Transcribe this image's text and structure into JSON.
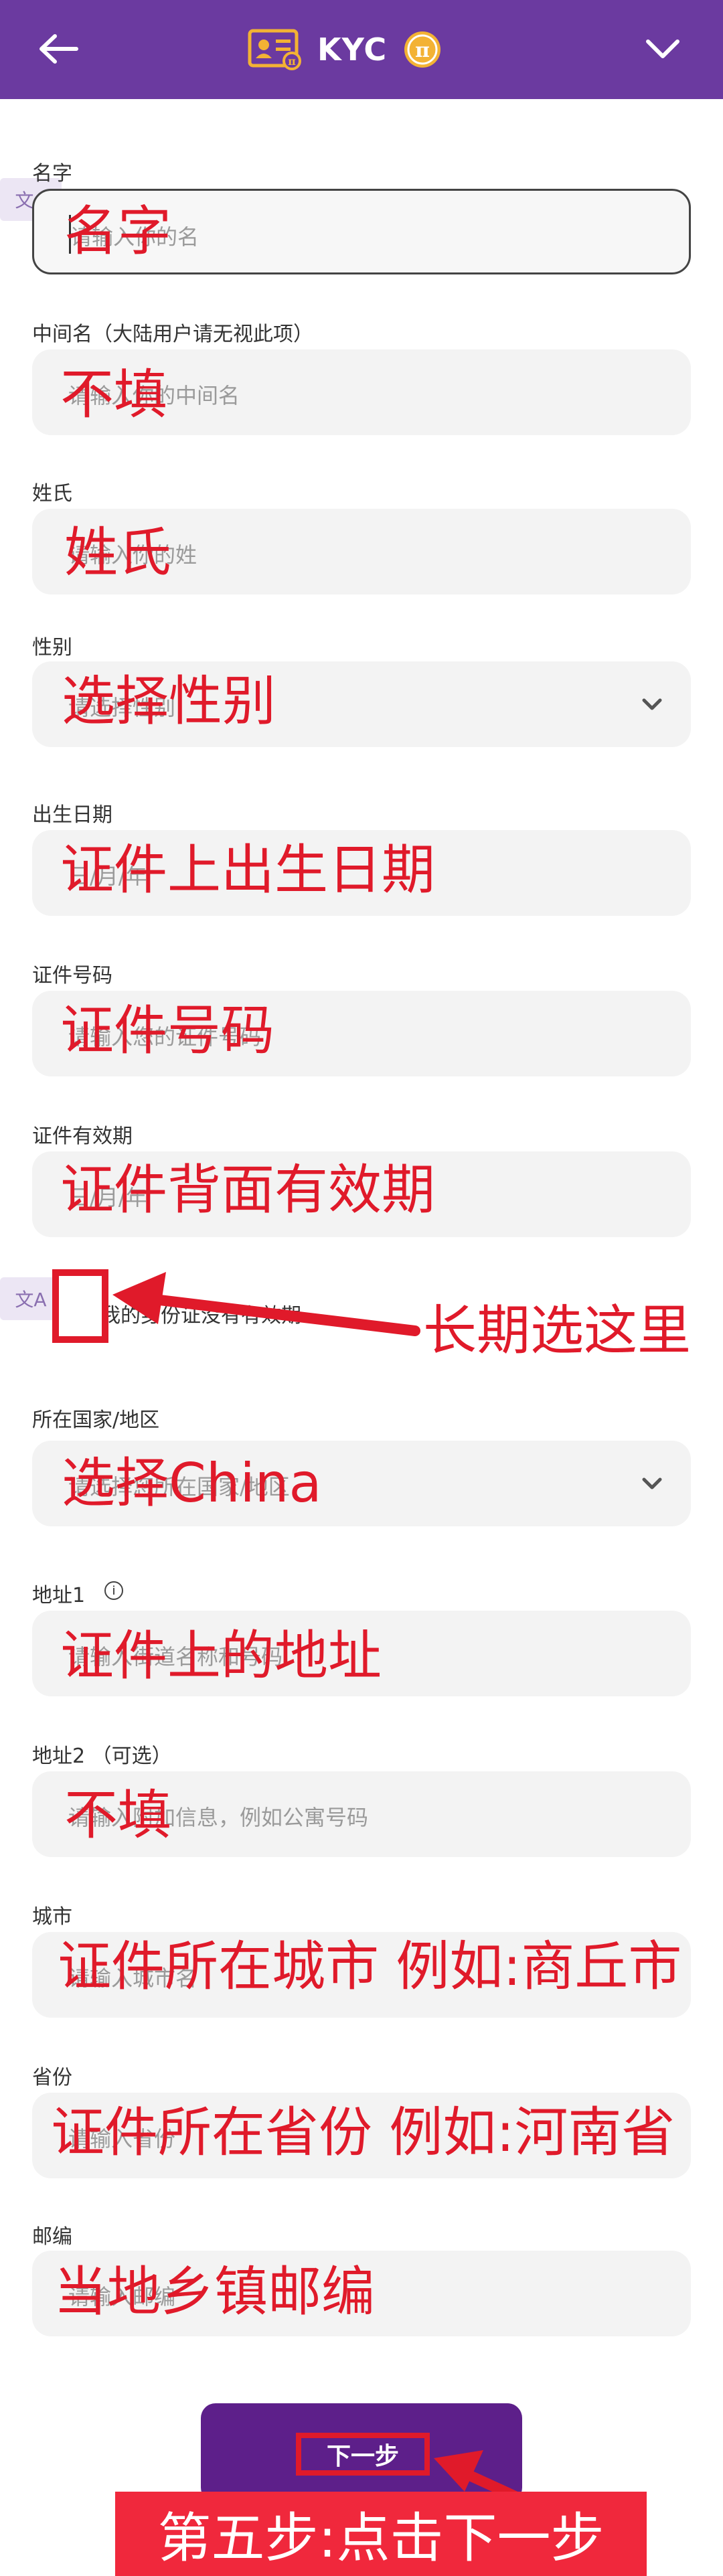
{
  "header": {
    "title": "KYC"
  },
  "fields": [
    {
      "label": "名字",
      "placeholder": "请输入你的名",
      "annotation": "名字"
    },
    {
      "label": "中间名（大陆用户请无视此项）",
      "placeholder": "请输入你的中间名",
      "annotation": "不填"
    },
    {
      "label": "姓氏",
      "placeholder": "请输入你的姓",
      "annotation": "姓氏"
    },
    {
      "label": "性别",
      "placeholder": "请选择性别",
      "annotation": "选择性别"
    },
    {
      "label": "出生日期",
      "placeholder": "日/月/年",
      "annotation": "证件上出生日期"
    },
    {
      "label": "证件号码",
      "placeholder": "请输入您的证件号码",
      "annotation": "证件号码"
    },
    {
      "label": "证件有效期",
      "placeholder": "日/月/年",
      "annotation": "证件背面有效期"
    },
    {
      "label": "所在国家/地区",
      "placeholder": "请选择您所在国家/地区",
      "annotation": "选择China"
    },
    {
      "label": "地址1",
      "placeholder": "请输入街道名称和号码",
      "annotation": "证件上的地址"
    },
    {
      "label": "地址2 （可选）",
      "placeholder": "请输入附加信息，例如公寓号码",
      "annotation": "不填"
    },
    {
      "label": "城市",
      "placeholder": "请输入城市名",
      "annotation": "证件所在城市 例如:商丘市"
    },
    {
      "label": "省份",
      "placeholder": "请输入省份",
      "annotation": "证件所在省份 例如:河南省"
    },
    {
      "label": "邮编",
      "placeholder": "请输入邮编",
      "annotation": "当地乡镇邮编"
    }
  ],
  "checkbox": {
    "label": "我的身份证没有有效期",
    "annotation": "长期选这里"
  },
  "translate_badge": "文A",
  "info_glyph": "i",
  "next_button": {
    "label": "下一步"
  },
  "banner": "第五步:点击下一步",
  "colors": {
    "header": "#6b3aa0",
    "button": "#5d1f8a",
    "annotation": "#e01a2a",
    "banner": "#f0283c",
    "coin": "#f3b234"
  }
}
